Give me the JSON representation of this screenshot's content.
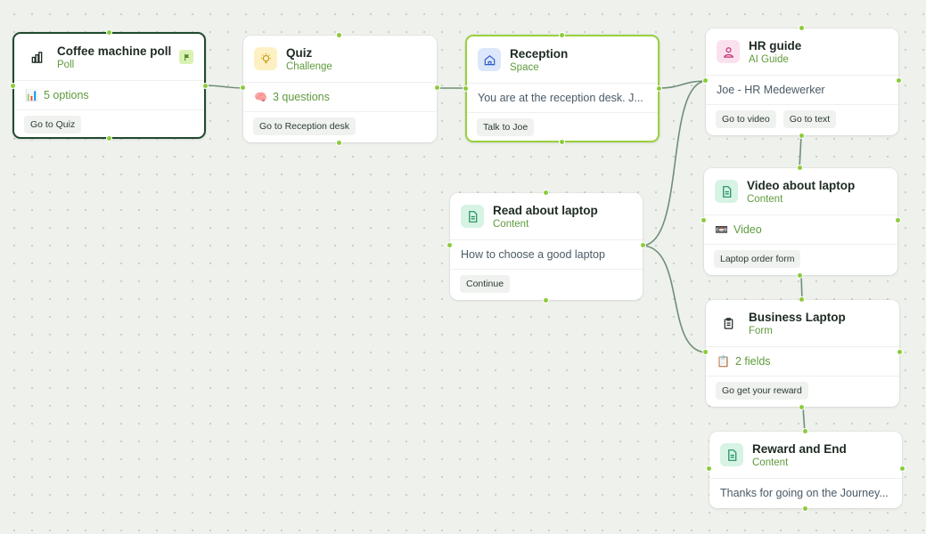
{
  "colors": {
    "accent_green": "#8dcb3c",
    "edge": "#6f8f78",
    "subtitle": "#5f9a3c",
    "selected_dark": "#1f4a2e",
    "selected_green": "#9ad13e"
  },
  "nodes": {
    "coffee": {
      "title": "Coffee machine poll",
      "subtitle": "Poll",
      "icon": "bar-chart-icon",
      "flag_icon": "flag-icon",
      "detail_emoji": "📊",
      "detail": "5 options",
      "actions": [
        "Go to Quiz"
      ]
    },
    "quiz": {
      "title": "Quiz",
      "subtitle": "Challenge",
      "icon": "lightbulb-icon",
      "detail_emoji": "🧠",
      "detail": "3 questions",
      "actions": [
        "Go to Reception desk"
      ]
    },
    "reception": {
      "title": "Reception",
      "subtitle": "Space",
      "icon": "home-icon",
      "detail": "You are at the reception desk. J...",
      "actions": [
        "Talk to Joe"
      ]
    },
    "hr_guide": {
      "title": "HR guide",
      "subtitle": "AI Guide",
      "icon": "user-icon",
      "detail": "Joe - HR Medewerker",
      "actions": [
        "Go to video",
        "Go to text"
      ]
    },
    "video_laptop": {
      "title": "Video about laptop",
      "subtitle": "Content",
      "icon": "document-icon",
      "detail_emoji": "📼",
      "detail": "Video",
      "actions": [
        "Laptop order form"
      ]
    },
    "read_laptop": {
      "title": "Read about laptop",
      "subtitle": "Content",
      "icon": "document-icon",
      "detail": "How to choose a good laptop",
      "actions": [
        "Continue"
      ]
    },
    "business_laptop": {
      "title": "Business Laptop",
      "subtitle": "Form",
      "icon": "clipboard-icon",
      "detail_emoji": "📋",
      "detail": "2 fields",
      "actions": [
        "Go get your reward"
      ]
    },
    "reward": {
      "title": "Reward and End",
      "subtitle": "Content",
      "icon": "document-icon",
      "detail": "Thanks for going on the Journey..."
    }
  }
}
